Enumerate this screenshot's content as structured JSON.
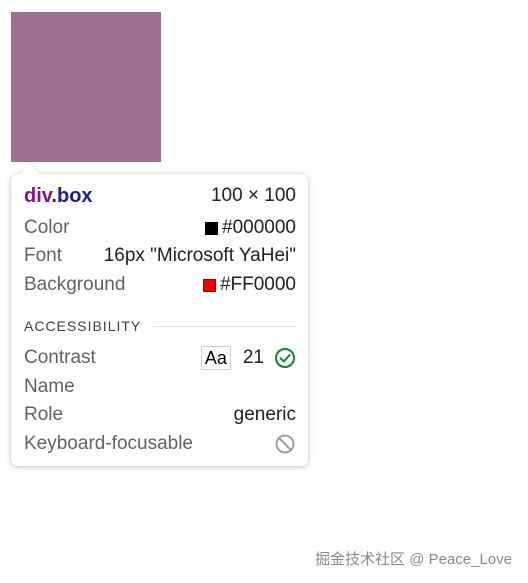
{
  "inspector_tooltip": {
    "tag": "div",
    "class_selector": ".box",
    "dimensions": "100 × 100",
    "color": {
      "label": "Color",
      "value": "#000000",
      "swatch": "#000000"
    },
    "font": {
      "label": "Font",
      "value": "16px \"Microsoft YaHei\""
    },
    "background": {
      "label": "Background",
      "value": "#FF0000",
      "swatch": "#ee0000"
    },
    "accessibility": {
      "header": "ACCESSIBILITY",
      "contrast": {
        "label": "Contrast",
        "sample": "Aa",
        "ratio": "21",
        "status_icon": "check-circle-icon"
      },
      "name": {
        "label": "Name",
        "value": ""
      },
      "role": {
        "label": "Role",
        "value": "generic"
      },
      "keyboard_focusable": {
        "label": "Keyboard-focusable",
        "status_icon": "no-entry-icon"
      }
    }
  },
  "highlight": {
    "color": "#a0708e"
  },
  "watermark": "掘金技术社区 @ Peace_Love"
}
